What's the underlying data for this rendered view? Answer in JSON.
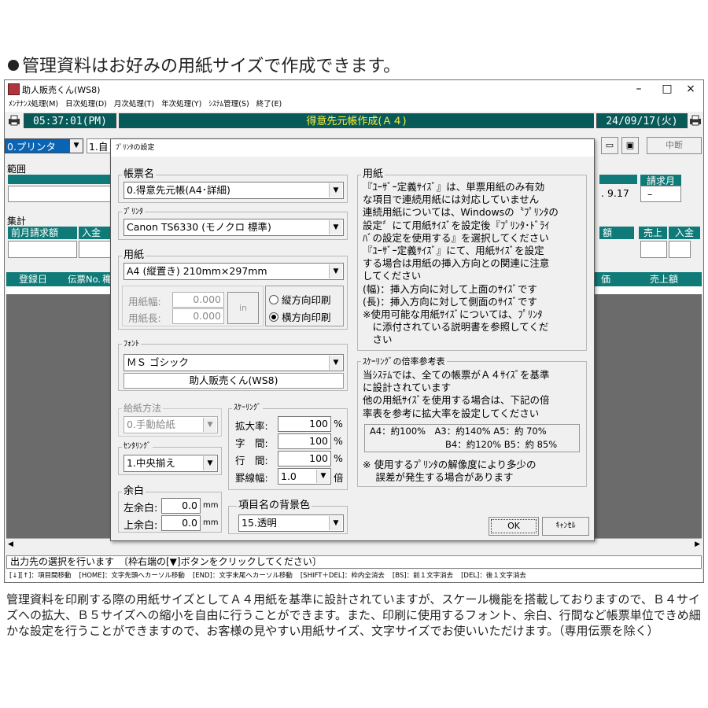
{
  "headline": "管理資料はお好みの用紙サイズで作成できます。",
  "window": {
    "title": "助人販売くん(WS8)",
    "controls": [
      "–",
      "□",
      "×"
    ],
    "menu": [
      "ﾒﾝﾃﾅﾝｽ処理(M)",
      "日次処理(D)",
      "月次処理(T)",
      "年次処理(Y)",
      "ｼｽﾃﾑ管理(S)",
      "終了(E)"
    ],
    "clock": "05:37:01(PM)",
    "screen_title": "得意先元帳作成(Ａ４)",
    "date": "24/09/17(火)",
    "output_select": "0.プリンタ",
    "output_next": "1.自",
    "cancel_button": "中断",
    "range_label": "範囲",
    "billing_month_label": "請求月",
    "billing_date_value": ". 9.17",
    "billing_month_value": "–",
    "totals_label": "集計",
    "totals_headers": [
      "前月請求額",
      "入金"
    ],
    "totals_right_headers": [
      "額",
      "売上",
      "入金"
    ],
    "table_headers": [
      "登録日",
      "伝票No.",
      "穐"
    ],
    "table_right_headers": [
      "価",
      "売上額"
    ],
    "message": "出力先の選択を行います　〔枠右端の[▼]ボタンをクリックしてください〕",
    "keys": [
      "[↓][↑]：項目間移動",
      "[HOME]：文字先頭へカーソル移動",
      "[END]：文字末尾へカーソル移動",
      "[SHIFT＋DEL]：枠内全消去",
      "[BS]：前１文字消去",
      "[DEL]：後１文字消去"
    ]
  },
  "dialog": {
    "title": "ﾌﾟﾘﾝﾀの設定",
    "form_label": "帳票名",
    "form_value": "0.得意先元帳(A4･詳細)",
    "printer_label": "ﾌﾟﾘﾝﾀ",
    "printer_value": "Canon TS6330 (モノクロ 標準)",
    "paper_label": "用紙",
    "paper_value": "A4 (縦置き) 210mm×297mm",
    "width_label": "用紙幅:",
    "width_value": "0.000",
    "length_label": "用紙長:",
    "length_value": "0.000",
    "unit_button": "in",
    "portrait_label": "縦方向印刷",
    "landscape_label": "横方向印刷",
    "font_label": "ﾌｫﾝﾄ",
    "font_value": "ＭＳ ゴシック",
    "font_preview": "助人販売くん(WS8)",
    "feed_label": "給紙方法",
    "feed_value": "0.手動給紙",
    "centering_label": "ｾﾝﾀﾘﾝｸﾞ",
    "centering_value": "1.中央揃え",
    "margin_label": "余白",
    "left_margin_label": "左余白:",
    "left_margin_value": "0.0",
    "top_margin_label": "上余白:",
    "top_margin_value": "0.0",
    "mm_unit": "mm",
    "scaling_label": "ｽｹｰﾘﾝｸﾞ",
    "zoom_label": "拡大率:",
    "zoom_value": "100",
    "char_label": "字　間:",
    "char_value": "100",
    "line_label": "行　間:",
    "line_value": "100",
    "percent": "%",
    "rule_label": "罫線幅:",
    "rule_value": "1.0",
    "rule_unit": "倍",
    "bgcolor_label": "項目名の背景色",
    "bgcolor_value": "15.透明",
    "paper_note_label": "用紙",
    "paper_note_lines": [
      "『ﾕｰｻﾞｰ定義ｻｲｽﾞ』は、単票用紙のみ有効",
      "な項目で連続用紙には対応していません",
      "連続用紙については、Windowsの〝ﾌﾟﾘﾝﾀの",
      "設定〞にて用紙ｻｲｽﾞを設定後『ﾌﾟﾘﾝﾀ･ﾄﾞﾗｲ",
      "ﾊﾞの設定を使用する』を選択してください",
      "『ﾕｰｻﾞｰ定義ｻｲｽﾞ』にて、用紙ｻｲｽﾞを設定",
      "する場合は用紙の挿入方向との関連に注意",
      "してください",
      "(幅)：挿入方向に対して上面のｻｲｽﾞです",
      "(長)：挿入方向に対して側面のｻｲｽﾞです",
      "※使用可能な用紙ｻｲｽﾞについては、ﾌﾟﾘﾝﾀ",
      "　に添付されている説明書を参照してくだ",
      "　さい"
    ],
    "scale_note_label": "ｽｹｰﾘﾝｸﾞの倍率参考表",
    "scale_note_lines": [
      "当ｼｽﾃﾑでは、全ての帳票がＡ４ｻｲｽﾞを基準",
      "に設計されています",
      "他の用紙ｻｲｽﾞを使用する場合は、下記の倍",
      "率表を参考に拡大率を設定してください"
    ],
    "ratio_line1": "A4：約100%　A3：約140% A5：約 70%",
    "ratio_line2": "B4：約120% B5：約 85%",
    "resolution_note_lines": [
      "※ 使用するﾌﾟﾘﾝﾀの解像度により多少の",
      "　 誤差が発生する場合があります"
    ],
    "ok_button": "OK",
    "cancel_button": "ｷｬﾝｾﾙ"
  },
  "caption": "管理資料を印刷する際の用紙サイズとしてＡ４用紙を基準に設計されていますが、スケール機能を搭載しておりますので、Ｂ４サイズへの拡大、Ｂ５サイズへの縮小を自由に行うことができます。また、印刷に使用するフォント、余白、行間など帳票単位できめ細かな設定を行うことができますので、お客様の見やすい用紙サイズ、文字サイズでお使いいただけます。（専用伝票を除く）"
}
